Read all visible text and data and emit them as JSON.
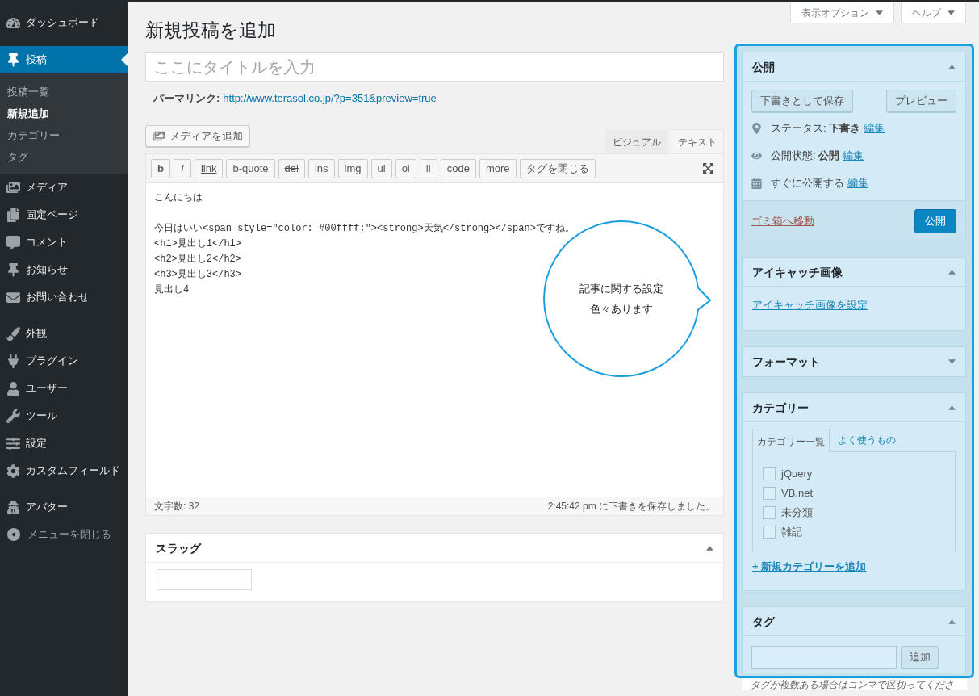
{
  "sidebar": {
    "groups": [
      {
        "items": [
          {
            "label": "ダッシュボード",
            "selected": false
          }
        ]
      },
      {
        "items": [
          {
            "label": "投稿",
            "selected": true,
            "children": [
              {
                "label": "投稿一覧",
                "selected": false
              },
              {
                "label": "新規追加",
                "selected": true
              },
              {
                "label": "カテゴリー",
                "selected": false
              },
              {
                "label": "タグ",
                "selected": false
              }
            ]
          },
          {
            "label": "メディア",
            "selected": false
          },
          {
            "label": "固定ページ",
            "selected": false
          },
          {
            "label": "コメント",
            "selected": false
          },
          {
            "label": "お知らせ",
            "selected": false
          },
          {
            "label": "お問い合わせ",
            "selected": false
          }
        ]
      },
      {
        "items": [
          {
            "label": "外観",
            "selected": false
          },
          {
            "label": "プラグイン",
            "selected": false
          },
          {
            "label": "ユーザー",
            "selected": false
          },
          {
            "label": "ツール",
            "selected": false
          },
          {
            "label": "設定",
            "selected": false
          },
          {
            "label": "カスタムフィールド",
            "selected": false
          }
        ]
      },
      {
        "items": [
          {
            "label": "アバター",
            "selected": false
          }
        ]
      }
    ],
    "collapse_button": "メニューを閉じる"
  },
  "screen_options": [
    {
      "label": "表示オプション"
    },
    {
      "label": "ヘルプ"
    }
  ],
  "page_title": "新規投稿を追加",
  "title_field": {
    "placeholder": "ここにタイトルを入力"
  },
  "permalink": {
    "label": "パーマリンク:",
    "url": "http://www.terasol.co.jp/?p=351&preview=true"
  },
  "editor": {
    "add_media_button": "メディアを追加",
    "tabs": [
      {
        "label": "ビジュアル",
        "selected": false
      },
      {
        "label": "テキスト",
        "selected": true
      }
    ],
    "toolbar": [
      {
        "label": "b",
        "kind": "bold"
      },
      {
        "label": "i",
        "kind": "italic"
      },
      {
        "label": "link",
        "kind": "underline"
      },
      {
        "label": "b-quote",
        "kind": "plain"
      },
      {
        "label": "del",
        "kind": "strike"
      },
      {
        "label": "ins",
        "kind": "plain"
      },
      {
        "label": "img",
        "kind": "plain"
      },
      {
        "label": "ul",
        "kind": "plain"
      },
      {
        "label": "ol",
        "kind": "plain"
      },
      {
        "label": "li",
        "kind": "plain"
      },
      {
        "label": "code",
        "kind": "plain"
      },
      {
        "label": "more",
        "kind": "plain"
      },
      {
        "label": "タグを閉じる",
        "kind": "plain"
      }
    ],
    "content": [
      {
        "lines": [
          "こんにちは"
        ]
      },
      {
        "lines": [
          "今日はいい<span style=\"color: #00ffff;\"><strong>天気</strong></span>ですね。",
          "<h1>見出し1</h1>",
          "<h2>見出し2</h2>",
          "<h3>見出し3</h3>",
          "見出し4"
        ]
      }
    ],
    "word_count": "文字数: 32",
    "autosave_status": "2:45:42 pm に下書きを保存しました。"
  },
  "annotation": {
    "lines": [
      "記事に関する設定",
      "色々あります"
    ]
  },
  "slug_box": {
    "title": "スラッグ",
    "expanded": true
  },
  "publish_box": {
    "title": "公開",
    "expanded": true,
    "save_draft_button": "下書きとして保存",
    "preview_button": "プレビュー",
    "rows": [
      {
        "text": "ステータス: **下書き**",
        "link": "編集"
      },
      {
        "text": "公開状態: **公開**",
        "link": "編集"
      },
      {
        "text": "すぐに公開する",
        "link": "編集"
      }
    ],
    "trash_link": "ゴミ箱へ移動",
    "publish_button": "公開"
  },
  "featured_image_box": {
    "title": "アイキャッチ画像",
    "expanded": true,
    "link": "アイキャッチ画像を設定"
  },
  "format_box": {
    "title": "フォーマット",
    "expanded": false
  },
  "category_box": {
    "title": "カテゴリー",
    "expanded": true,
    "tabs": [
      {
        "label": "カテゴリー一覧",
        "selected": true
      },
      {
        "label": "よく使うもの",
        "selected": false
      }
    ],
    "items": [
      {
        "label": "jQuery",
        "checked": false
      },
      {
        "label": "VB.net",
        "checked": false
      },
      {
        "label": "未分類",
        "checked": false
      },
      {
        "label": "雑記",
        "checked": false
      }
    ],
    "add_link": "+ 新規カテゴリーを追加"
  },
  "tag_box": {
    "title": "タグ",
    "expanded": true,
    "add_button": "追加",
    "hint": "タグが複数ある場合はコンマで区切ってくださ"
  }
}
